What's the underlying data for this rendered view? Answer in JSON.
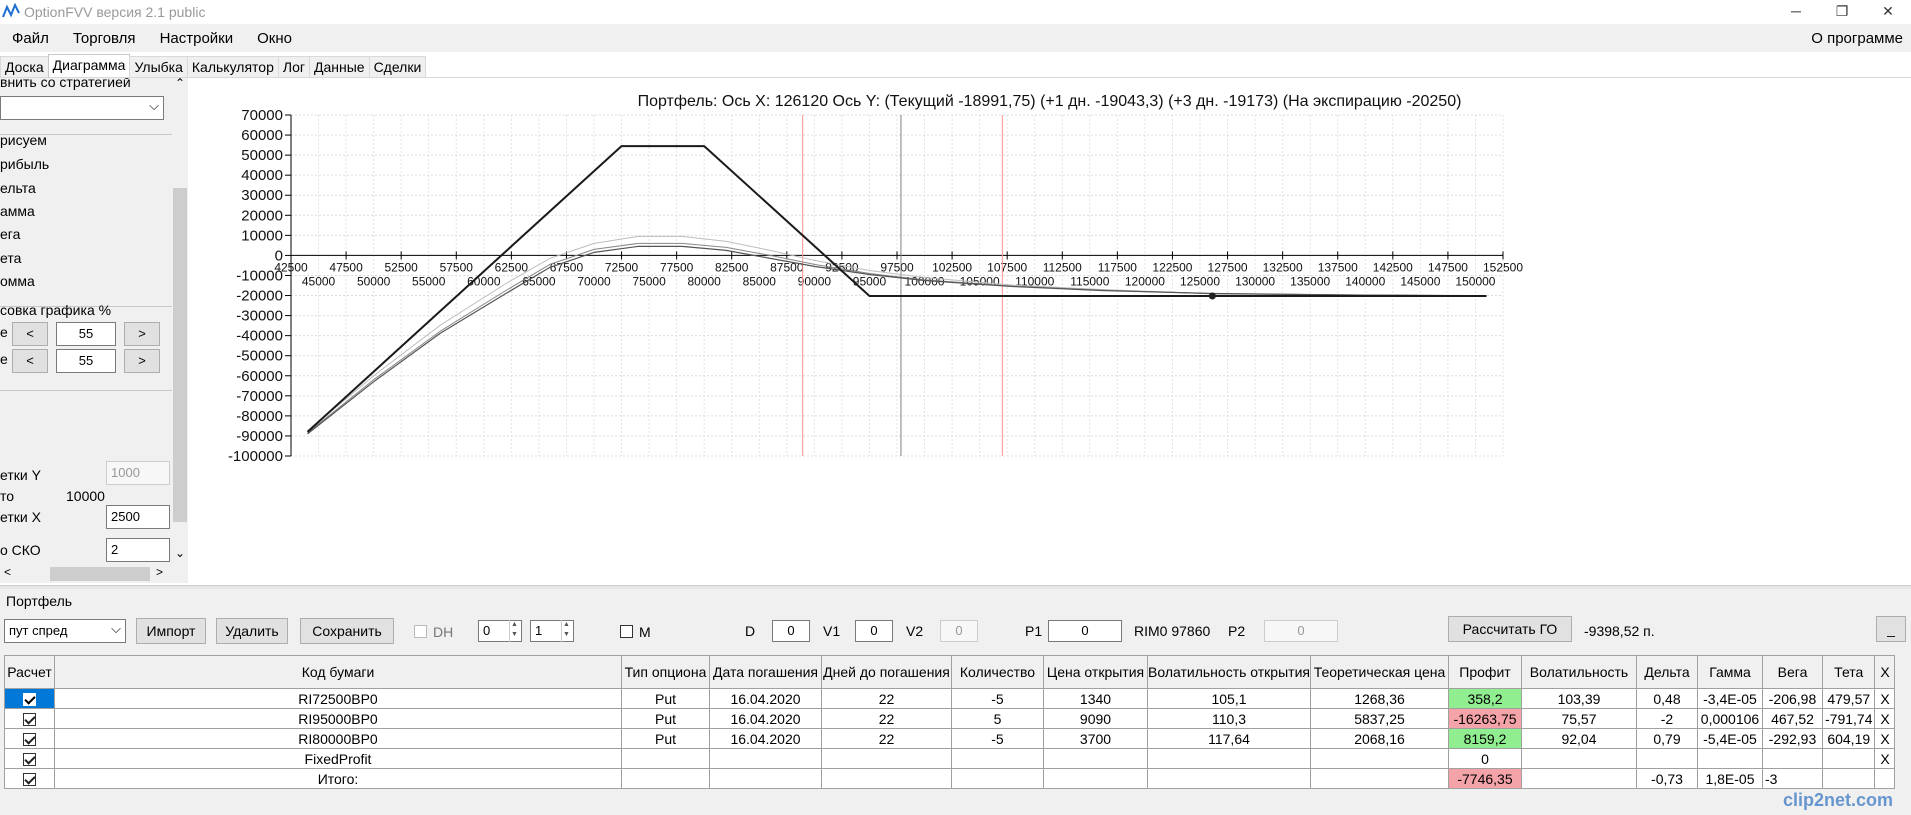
{
  "window": {
    "title": "OptionFVV версия 2.1 public"
  },
  "menu": {
    "items": [
      "Файл",
      "Торговля",
      "Настройки",
      "Окно"
    ],
    "about": "О программе"
  },
  "tabs": [
    "Доска",
    "Диаграмма",
    "Улыбка",
    "Калькулятор",
    "Лог",
    "Данные",
    "Сделки"
  ],
  "left_panel": {
    "compare_label": "внить со стратегией",
    "draw_label": "рисуем",
    "options": [
      "рибыль",
      "ельта",
      "амма",
      "ега",
      "ета",
      "омма"
    ],
    "scale_label": "совка графика %",
    "row1_label": "е",
    "row1_prev": "<",
    "row1_value": "55",
    "row1_next": ">",
    "row2_label": "е",
    "row2_prev": "<",
    "row2_value": "55",
    "row2_next": ">",
    "grid_y_label": "етки Y",
    "grid_y_value": "1000",
    "total_label": "то",
    "total_value": "10000",
    "grid_x_label": "етки X",
    "grid_x_value": "2500",
    "sko_label": "о СКО",
    "sko_value": "2"
  },
  "chart_data": {
    "type": "line",
    "title": "Портфель: Ось X: 126120 Ось Y:  (Текущий -18991,75)  (+1 дн. -19043,3)  (+3 дн. -19173)  (На экспирацию -20250)",
    "ylim": [
      -100000,
      70000
    ],
    "xlim": [
      42500,
      152500
    ],
    "y_ticks": [
      "70000",
      "60000",
      "50000",
      "40000",
      "30000",
      "20000",
      "10000",
      "0",
      "-10000",
      "-20000",
      "-30000",
      "-40000",
      "-50000",
      "-60000",
      "-70000",
      "-80000",
      "-90000",
      "-100000"
    ],
    "x_ticks_upper": [
      "42500",
      "47500",
      "52500",
      "57500",
      "62500",
      "67500",
      "72500",
      "77500",
      "82500",
      "87500",
      "92500",
      "97500",
      "102500",
      "107500",
      "112500",
      "117500",
      "122500",
      "127500",
      "132500",
      "137500",
      "142500",
      "147500",
      "152500"
    ],
    "x_ticks_lower": [
      "45000",
      "50000",
      "55000",
      "60000",
      "65000",
      "70000",
      "75000",
      "80000",
      "85000",
      "90000",
      "95000",
      "100000",
      "105000",
      "110000",
      "115000",
      "120000",
      "125000",
      "130000",
      "135000",
      "140000",
      "145000",
      "150000"
    ],
    "vlines": [
      {
        "x": 97860,
        "color": "#808080"
      },
      {
        "x": 88940,
        "color": "#ff9090"
      },
      {
        "x": 107060,
        "color": "#ff9090"
      }
    ],
    "marker": {
      "x": 126120,
      "y": -20250
    },
    "series": [
      {
        "color": "#1a1a1a",
        "width": 2,
        "points": [
          [
            44000,
            -88000
          ],
          [
            72500,
            54500
          ],
          [
            80000,
            54500
          ],
          [
            95000,
            -20250
          ],
          [
            151000,
            -20250
          ]
        ]
      },
      {
        "color": "#555555",
        "width": 1.2,
        "points": [
          [
            44000,
            -89000
          ],
          [
            50000,
            -63000
          ],
          [
            56000,
            -39000
          ],
          [
            62000,
            -19000
          ],
          [
            66000,
            -6000
          ],
          [
            70000,
            1500
          ],
          [
            74000,
            4500
          ],
          [
            78000,
            4500
          ],
          [
            82000,
            2500
          ],
          [
            86000,
            -1500
          ],
          [
            90000,
            -5500
          ],
          [
            95000,
            -9500
          ],
          [
            100000,
            -12500
          ],
          [
            108000,
            -15500
          ],
          [
            116000,
            -17500
          ],
          [
            126120,
            -18992
          ],
          [
            140000,
            -19800
          ],
          [
            151000,
            -20100
          ]
        ]
      },
      {
        "color": "#888888",
        "width": 1,
        "points": [
          [
            44000,
            -88500
          ],
          [
            50000,
            -62000
          ],
          [
            56000,
            -38000
          ],
          [
            62000,
            -17500
          ],
          [
            66000,
            -4500
          ],
          [
            70000,
            3000
          ],
          [
            74000,
            6000
          ],
          [
            78000,
            6000
          ],
          [
            82000,
            4000
          ],
          [
            86000,
            0
          ],
          [
            90000,
            -4500
          ],
          [
            95000,
            -9000
          ],
          [
            100000,
            -12200
          ],
          [
            108000,
            -15300
          ],
          [
            116000,
            -17300
          ],
          [
            126120,
            -19043
          ],
          [
            140000,
            -19800
          ],
          [
            151000,
            -20100
          ]
        ]
      },
      {
        "color": "#bdbdbd",
        "width": 1,
        "points": [
          [
            44000,
            -87500
          ],
          [
            50000,
            -60000
          ],
          [
            56000,
            -35000
          ],
          [
            62000,
            -14000
          ],
          [
            66000,
            -1500
          ],
          [
            70000,
            6000
          ],
          [
            74000,
            9500
          ],
          [
            78000,
            9500
          ],
          [
            82000,
            7000
          ],
          [
            86000,
            2500
          ],
          [
            90000,
            -2500
          ],
          [
            95000,
            -7500
          ],
          [
            100000,
            -11000
          ],
          [
            108000,
            -14800
          ],
          [
            116000,
            -17000
          ],
          [
            126120,
            -19173
          ],
          [
            140000,
            -19900
          ],
          [
            151000,
            -20150
          ]
        ]
      }
    ]
  },
  "portfolio": {
    "label": "Портфель",
    "strategy_value": "пут спред",
    "import": "Импорт",
    "delete": "Удалить",
    "save": "Сохранить",
    "dh_label": "DH",
    "spin1": "0",
    "spin2": "1",
    "m_label": "M",
    "d_label": "D",
    "d_value": "0",
    "v1_label": "V1",
    "v1_value": "0",
    "v2_label": "V2",
    "v2_value": "0",
    "p1_label": "P1",
    "p1_value": "0",
    "rim_label": "RIM0 97860",
    "p2_label": "P2",
    "p2_value": "0",
    "calc_go": "Рассчитать ГО",
    "go_value": "-9398,52 п.",
    "min_button": "_"
  },
  "table": {
    "headers": [
      "Расчет",
      "Код бумаги",
      "Тип опциона",
      "Дата погашения",
      "Дней до погашения",
      "Количество",
      "Цена открытия",
      "Волатильность открытия",
      "Теоретическая цена",
      "Профит",
      "Волатильность",
      "Дельта",
      "Гамма",
      "Вега",
      "Тета",
      "X"
    ],
    "rows": [
      {
        "code": "RI72500BP0",
        "type": "Put",
        "date": "16.04.2020",
        "days": "22",
        "qty": "-5",
        "price": "1340",
        "vol_open": "105,1",
        "theo": "1268,36",
        "profit": "358,2",
        "vol": "103,39",
        "delta": "0,48",
        "gamma": "-3,4E-05",
        "vega": "-206,98",
        "theta": "479,57",
        "x": "X"
      },
      {
        "code": "RI95000BP0",
        "type": "Put",
        "date": "16.04.2020",
        "days": "22",
        "qty": "5",
        "price": "9090",
        "vol_open": "110,3",
        "theo": "5837,25",
        "profit": "-16263,75",
        "vol": "75,57",
        "delta": "-2",
        "gamma": "0,000106",
        "vega": "467,52",
        "theta": "-791,74",
        "x": "X"
      },
      {
        "code": "RI80000BP0",
        "type": "Put",
        "date": "16.04.2020",
        "days": "22",
        "qty": "-5",
        "price": "3700",
        "vol_open": "117,64",
        "theo": "2068,16",
        "profit": "8159,2",
        "vol": "92,04",
        "delta": "0,79",
        "gamma": "-5,4E-05",
        "vega": "-292,93",
        "theta": "604,19",
        "x": "X"
      }
    ],
    "fixed_label": "FixedProfit",
    "fixed_profit": "0",
    "fixed_x": "X",
    "total_label": "Итого:",
    "total_profit": "-7746,35",
    "total_delta": "-0,73",
    "total_gamma": "1,8E-05",
    "total_vega": "-3"
  },
  "watermark": "clip2net.com"
}
